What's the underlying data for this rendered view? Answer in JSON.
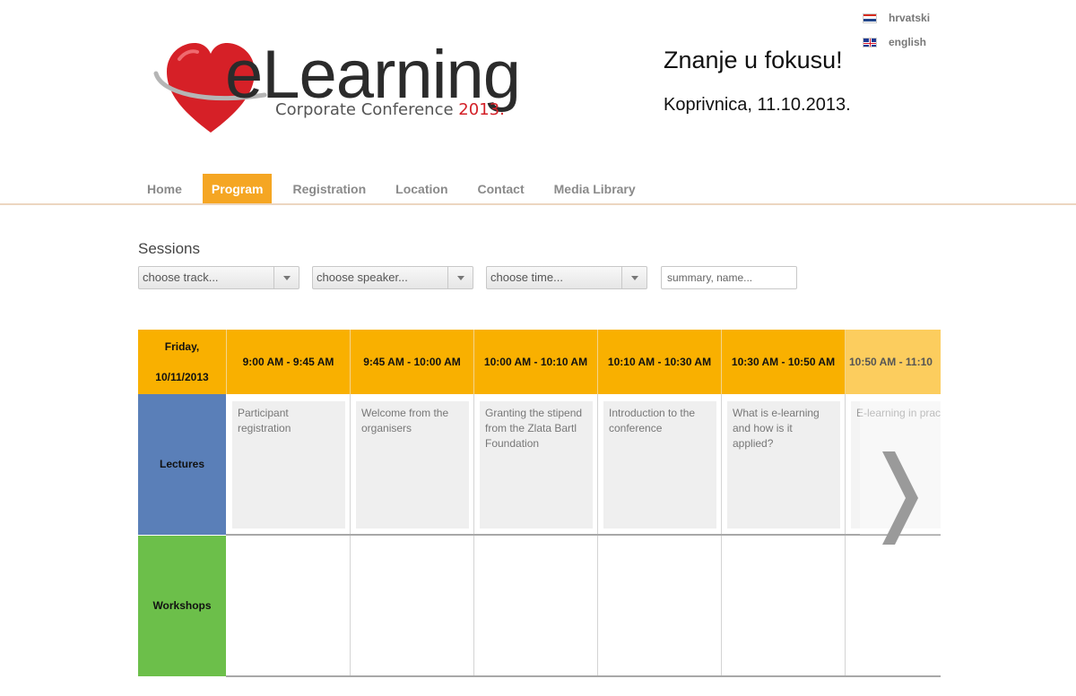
{
  "languages": [
    {
      "label": "hrvatski"
    },
    {
      "label": "english"
    }
  ],
  "logo": {
    "main": "eLearning",
    "sub": "Corporate Conference",
    "year": "2013."
  },
  "slogan": "Znanje u fokusu!",
  "event_date": "Koprivnica, 11.10.2013.",
  "nav": {
    "items": [
      {
        "label": "Home"
      },
      {
        "label": "Program",
        "active": true
      },
      {
        "label": "Registration"
      },
      {
        "label": "Location"
      },
      {
        "label": "Contact"
      },
      {
        "label": "Media Library"
      }
    ]
  },
  "sessions": {
    "title": "Sessions",
    "track_filter": "choose track...",
    "speaker_filter": "choose speaker...",
    "time_filter": "choose time...",
    "search_placeholder": "summary, name..."
  },
  "schedule": {
    "day_line1": "Friday,",
    "day_line2": "10/11/2013",
    "time_slots": [
      "9:00 AM - 9:45 AM",
      "9:45 AM - 10:00 AM",
      "10:00 AM - 10:10 AM",
      "10:10 AM - 10:30 AM",
      "10:30 AM - 10:50 AM",
      "10:50 AM - 11:10"
    ],
    "tracks": [
      "Lectures",
      "Workshops"
    ],
    "lectures": [
      "Participant registration",
      "Welcome from the organisers",
      "Granting the stipend from the Zlata Bartl Foundation",
      "Introduction to the conference",
      "What is e-learning and how is it applied?",
      "E-learning in pract"
    ],
    "next_arrow_glyph": "❯"
  },
  "colors": {
    "accent_orange": "#f5a623",
    "header_orange": "#f9b000",
    "lectures_blue": "#5a7fb8",
    "workshops_green": "#6cbf4a",
    "logo_red": "#d32027"
  }
}
